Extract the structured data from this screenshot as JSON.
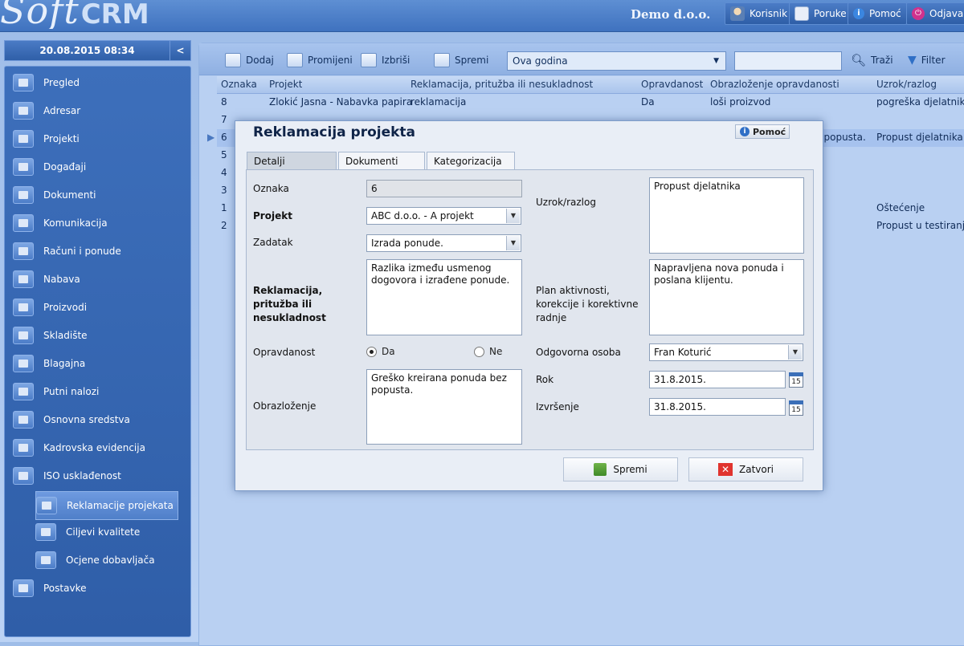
{
  "app": {
    "logo_soft": "Soft",
    "logo_crm": "CRM",
    "company": "Demo d.o.o."
  },
  "top_buttons": [
    {
      "label": "Korisnik",
      "icon": "user-icon"
    },
    {
      "label": "Poruke",
      "icon": "envelope-icon"
    },
    {
      "label": "Pomoć",
      "icon": "info-icon"
    },
    {
      "label": "Odjava",
      "icon": "power-icon"
    }
  ],
  "sidebar": {
    "datetime": "20.08.2015 08:34",
    "collapse": "<",
    "items": [
      {
        "label": "Pregled"
      },
      {
        "label": "Adresar"
      },
      {
        "label": "Projekti"
      },
      {
        "label": "Događaji"
      },
      {
        "label": "Dokumenti"
      },
      {
        "label": "Komunikacija"
      },
      {
        "label": "Računi i ponude"
      },
      {
        "label": "Nabava"
      },
      {
        "label": "Proizvodi"
      },
      {
        "label": "Skladište"
      },
      {
        "label": "Blagajna"
      },
      {
        "label": "Putni nalozi"
      },
      {
        "label": "Osnovna sredstva"
      },
      {
        "label": "Kadrovska evidencija"
      },
      {
        "label": "ISO usklađenost"
      },
      {
        "label": "Reklamacije projekata"
      },
      {
        "label": "Ciljevi kvalitete"
      },
      {
        "label": "Ocjene dobavljača"
      },
      {
        "label": "Postavke"
      }
    ]
  },
  "toolbar": {
    "add": "Dodaj",
    "edit": "Promijeni",
    "delete": "Izbriši",
    "save": "Spremi",
    "period": "Ova godina",
    "search": "Traži",
    "filter": "Filter"
  },
  "grid": {
    "headers": [
      "Oznaka",
      "Projekt",
      "Reklamacija, pritužba ili nesukladnost",
      "Opravdanost",
      "Obrazloženje opravdanosti",
      "Uzrok/razlog"
    ],
    "rows": [
      [
        "8",
        "Zlokić Jasna - Nabavka papira",
        "reklamacija",
        "Da",
        "loši proizvod",
        "pogreška djelatnika"
      ],
      [
        "7",
        "",
        "",
        "",
        "",
        ""
      ],
      [
        "6",
        "",
        "",
        "",
        "ez popusta.",
        "Propust djelatnika"
      ],
      [
        "5",
        "",
        "",
        "",
        "",
        ""
      ],
      [
        "4",
        "",
        "",
        "",
        "",
        ""
      ],
      [
        "3",
        "",
        "",
        "",
        "",
        ""
      ],
      [
        "1",
        "",
        "",
        "",
        "",
        "Oštećenje"
      ],
      [
        "2",
        "",
        "",
        "",
        "",
        "Propust u testiranju"
      ]
    ]
  },
  "dialog": {
    "title": "Reklamacija projekta",
    "help": "Pomoć",
    "tabs": [
      "Detalji",
      "Dokumenti",
      "Kategorizacija"
    ],
    "labels": {
      "oznaka": "Oznaka",
      "projekt": "Projekt",
      "zadatak": "Zadatak",
      "reklamacija": "Reklamacija, pritužba ili nesukladnost",
      "opravdanost": "Opravdanost",
      "obrazlozenje": "Obrazloženje",
      "uzrok": "Uzrok/razlog",
      "plan": "Plan aktivnosti, korekcije i korektivne radnje",
      "osoba": "Odgovorna osoba",
      "rok": "Rok",
      "izvrsenje": "Izvršenje"
    },
    "values": {
      "oznaka": "6",
      "projekt": "ABC d.o.o. - A projekt",
      "zadatak": "Izrada ponude.",
      "reklamacija": "Razlika između usmenog dogovora i izrađene ponude.",
      "opravdanost_da": "Da",
      "opravdanost_ne": "Ne",
      "obrazlozenje": "Greško kreirana ponuda bez popusta.",
      "uzrok": "Propust djelatnika",
      "plan": "Napravljena nova ponuda i poslana klijentu.",
      "osoba": "Fran Koturić",
      "rok": "31.8.2015.",
      "izvrsenje": "31.8.2015.",
      "cal_day": "15"
    },
    "buttons": {
      "save": "Spremi",
      "close": "Zatvori"
    }
  }
}
